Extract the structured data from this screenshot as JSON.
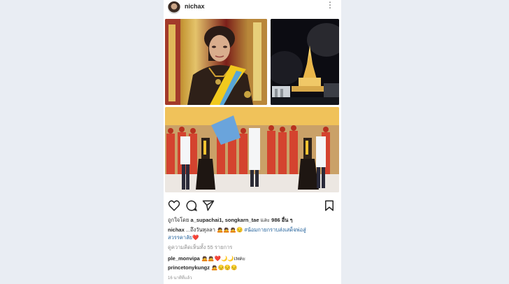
{
  "post": {
    "username": "nichax",
    "likes_prefix": "ถูกใจโดย",
    "likers": "a_supachai1, songkarn_tae",
    "likes_and": "และ",
    "likes_count": "986 อื่น ๆ",
    "caption_user": "nichax",
    "caption_text": " ...ถึงวันทุลลา",
    "caption_emoji": "🙇🙇🙇😔",
    "caption_hashtag_1": "#น้อมกายกราบส่งเสด็จพ่อสู่",
    "caption_hashtag_2": "สวรรคาลัย",
    "caption_heart": "❤️",
    "view_comments": "ดูความคิดเห็นทั้ง 55 รายการ",
    "comments": [
      {
        "user": "ple_monvipa",
        "text": "🙇🙇❤️🌙🌙เพคะ"
      },
      {
        "user": "princetonykungz",
        "text": "🙇😔😔😔"
      }
    ],
    "timestamp": "16 นาทีที่แล้ว"
  },
  "colors": {
    "accent_yellow": "#f2c230",
    "ceremonial_red": "#d4432f",
    "link": "#1f5f9a"
  },
  "icons": {
    "more": "more-vertical-icon",
    "like": "heart-icon",
    "comment": "comment-icon",
    "share": "send-icon",
    "save": "bookmark-icon"
  }
}
